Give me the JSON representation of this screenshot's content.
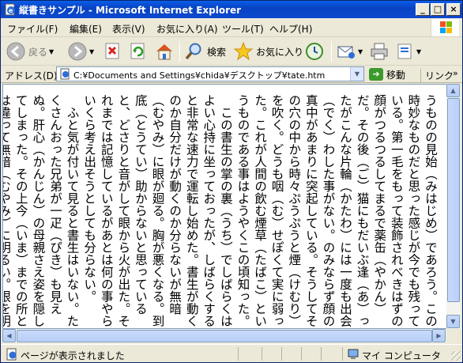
{
  "window": {
    "title": "縦書きサンプル - Microsoft Internet Explorer",
    "minimize": "_",
    "maximize": "□",
    "close": "×"
  },
  "menu": {
    "file": "ファイル(F)",
    "edit": "編集(E)",
    "view": "表示(V)",
    "favorites": "お気に入り(A)",
    "tools": "ツール(T)",
    "help": "ヘルプ(H)"
  },
  "toolbar": {
    "back": "戻る",
    "search": "検索",
    "favorites": "お気に入り"
  },
  "address": {
    "label": "アドレス(D)",
    "url": "C:¥Documents and Settings¥chida¥デスクトップ¥tate.htm",
    "go": "移動",
    "links": "リンク",
    "links_more": "»"
  },
  "content": {
    "text": "うものの見始（みはじめ）であろう。この時妙なものだと思った感じが今でも残っている。第一毛をもって装飾されべきはずの顔がつるつるしてまるで薬缶（やかん）だ。その後（ご）猫にもだいぶ逢（あ）ったがこんな片輪（かたわ）には一度も出会（でく）わした事がない。のみならず顔の真中があまりに突起している。そうしてその穴の中から時々ぷうぷうと煙（けむり）を吹く。どうも咽（む）せぽくて実に弱った。これが人間の飲む煙草（たばこ）というものである事はようやくこの頃知った。\n　この書生の掌の裏（うち）でしばらくはよい心持に坐っておったが、しばらくすると非常な速力で運転し始めた。書生が動くのか自分だけが動くのか分らないが無暗（むやみ）に眼が廻る。胸が悪くなる。到底（とうてい）助からないと思っていると、どさりと音がして眼から火が出た。それまでは記憶しているがあとは何の事やらいくら考え出そうとしても分らない。\n　ふと気が付いて見ると書生はいない。たくさんおった兄弟が一疋（ぴき）も見えぬ。肝心（かんじん）の母親さえ姿を隠してしまった。その上今（いま）までの所とは違って無暗（むやみ）に明るい。眼を明いていられぬくらいだ。はてな何でも容子（ようす）がおかしいと、のそのそ這（は）い出して見ると非常に痛い。吾輩は藁（わら）の上から急に笹原の中へ棄てられたのである。"
  },
  "status": {
    "text": "ページが表示されました",
    "zone": "マイ コンピュータ"
  }
}
